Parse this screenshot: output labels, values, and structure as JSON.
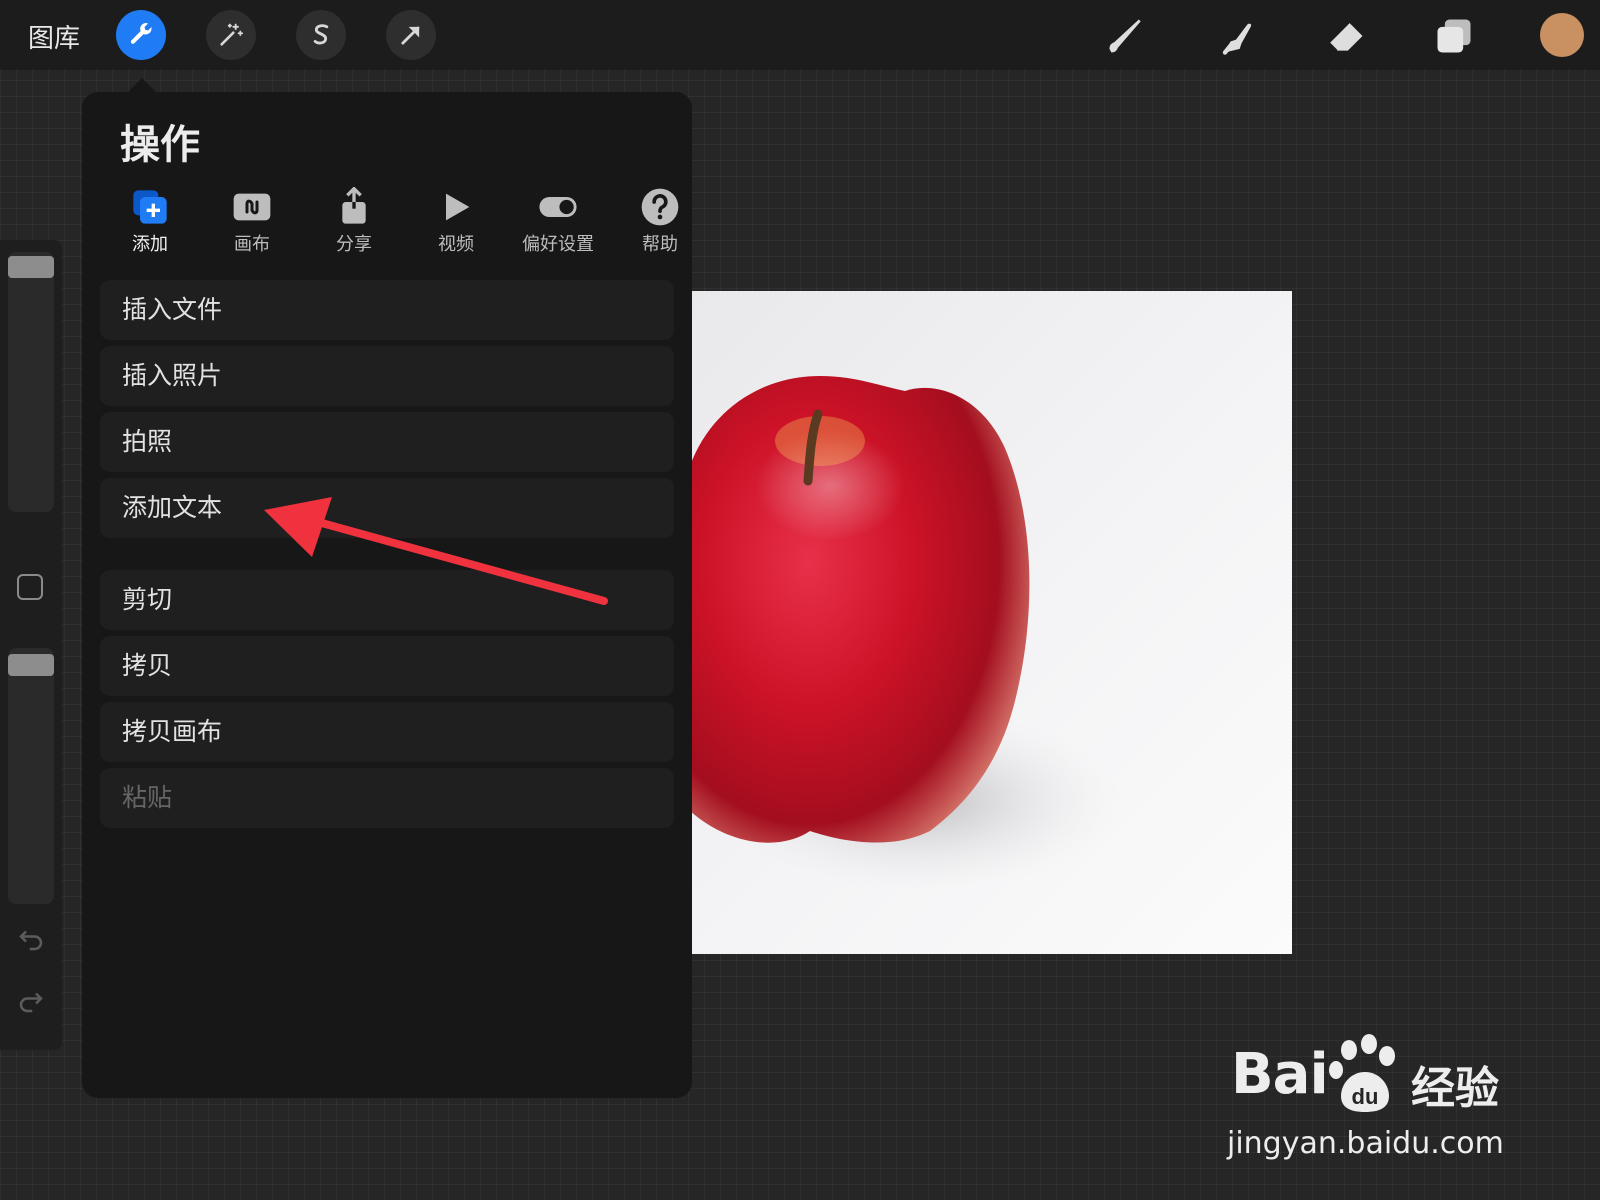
{
  "topbar": {
    "gallery_label": "图库",
    "left_tools": [
      "wrench-icon",
      "magic-wand-icon",
      "selection-s-icon",
      "transform-arrow-icon"
    ],
    "right_tools": [
      "brush-icon",
      "smudge-icon",
      "eraser-icon",
      "layers-icon"
    ],
    "current_color": "#c99062",
    "accent": "#1f7cf5"
  },
  "actions_panel": {
    "title": "操作",
    "tabs": [
      {
        "label": "添加",
        "icon": "add-image-icon",
        "active": true
      },
      {
        "label": "画布",
        "icon": "canvas-icon",
        "active": false
      },
      {
        "label": "分享",
        "icon": "share-icon",
        "active": false
      },
      {
        "label": "视频",
        "icon": "play-icon",
        "active": false
      },
      {
        "label": "偏好设置",
        "icon": "toggle-icon",
        "active": false
      },
      {
        "label": "帮助",
        "icon": "help-icon",
        "active": false
      }
    ],
    "items": [
      {
        "label": "插入文件"
      },
      {
        "label": "插入照片"
      },
      {
        "label": "拍照"
      },
      {
        "label": "添加文本"
      },
      {
        "label": "剪切"
      },
      {
        "label": "拷贝"
      },
      {
        "label": "拷贝画布"
      },
      {
        "label": "粘贴",
        "disabled": true
      }
    ]
  },
  "watermark": {
    "brand": "Bai",
    "brand_du": "du",
    "product": "经验",
    "url": "jingyan.baidu.com"
  }
}
